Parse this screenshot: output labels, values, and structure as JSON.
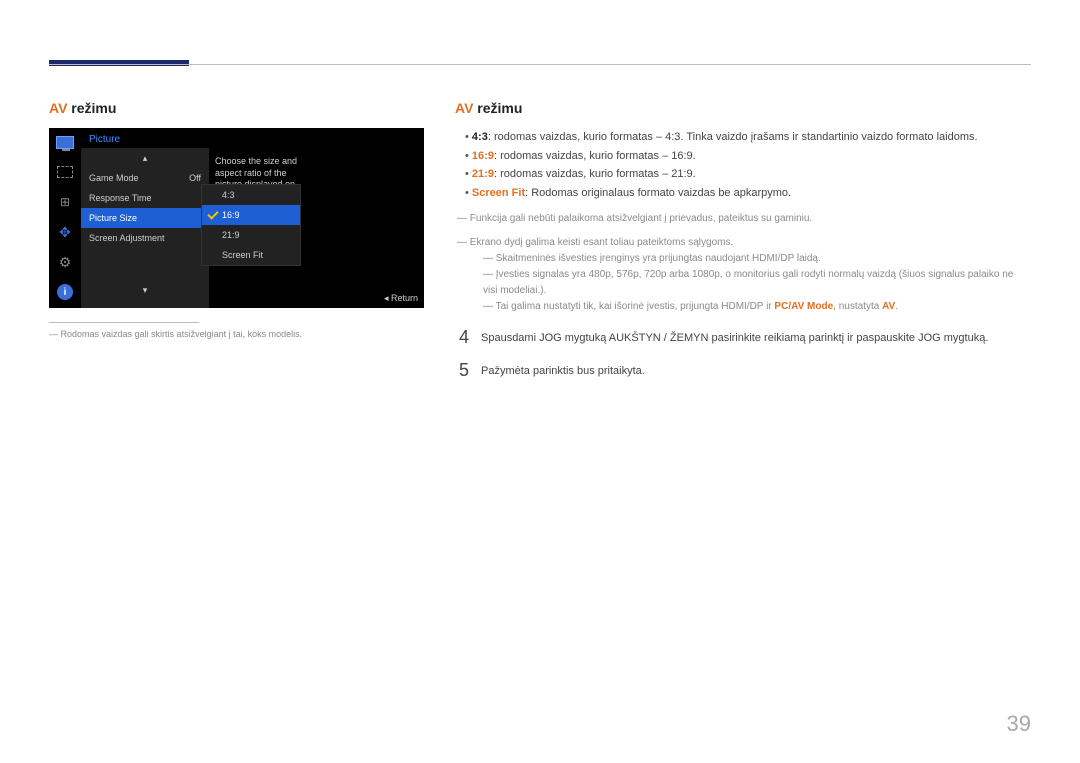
{
  "page_number": "39",
  "left": {
    "heading_orange": "AV",
    "heading_black": " režimu",
    "footnote": "Rodomas vaizdas gali skirtis atsižvelgiant į tai, koks modelis."
  },
  "osd": {
    "title": "Picture",
    "rows": {
      "game_mode": "Game Mode",
      "game_mode_val": "Off",
      "response": "Response Time",
      "picture_size": "Picture Size",
      "screen_adj": "Screen Adjustment"
    },
    "sub": {
      "r0": "4:3",
      "r1": "16:9",
      "r2": "21:9",
      "r3": "Screen Fit"
    },
    "help": "Choose the size and aspect ratio of the picture displayed on screen.",
    "return": "Return",
    "arrow_up": "▴",
    "arrow_down": "▾"
  },
  "right": {
    "heading_orange": "AV",
    "heading_black": " režimu",
    "bul": {
      "b0a": "4:3",
      "b0b": ": rodomas vaizdas, kurio formatas – 4:3. Tinka vaizdo įrašams ir standartinio vaizdo formato laidoms.",
      "b1a": "16:9",
      "b1b": ": rodomas vaizdas, kurio formatas – 16:9.",
      "b2a": "21:9",
      "b2b": ": rodomas vaizdas, kurio formatas – 21:9.",
      "b3a": "Screen Fit",
      "b3b": ": Rodomas originalaus formato vaizdas be apkarpymo."
    },
    "d0": "Funkcija gali nebūti palaikoma atsižvelgiant į prievadus, pateiktus su gaminiu.",
    "d1": "Ekrano dydį galima keisti esant toliau pateiktoms sąlygoms.",
    "s0": "Skaitmeninės išvesties įrenginys yra prijungtas naudojant HDMI/DP laidą.",
    "s1": "Įvesties signalas yra 480p, 576p, 720p arba 1080p, o monitorius gali rodyti normalų vaizdą (šiuos signalus palaiko ne visi modeliai.).",
    "s2a": "Tai galima nustatyti tik, kai išorinė įvestis, prijungta HDMI/DP ir ",
    "s2b": "PC/AV Mode",
    "s2c": ", nustatyta ",
    "s2d": "AV",
    "s2e": ".",
    "step4_num": "4",
    "step4": "Spausdami JOG mygtuką AUKŠTYN / ŽEMYN pasirinkite reikiamą parinktį ir paspauskite JOG mygtuką.",
    "step5_num": "5",
    "step5": "Pažymėta parinktis bus pritaikyta."
  }
}
